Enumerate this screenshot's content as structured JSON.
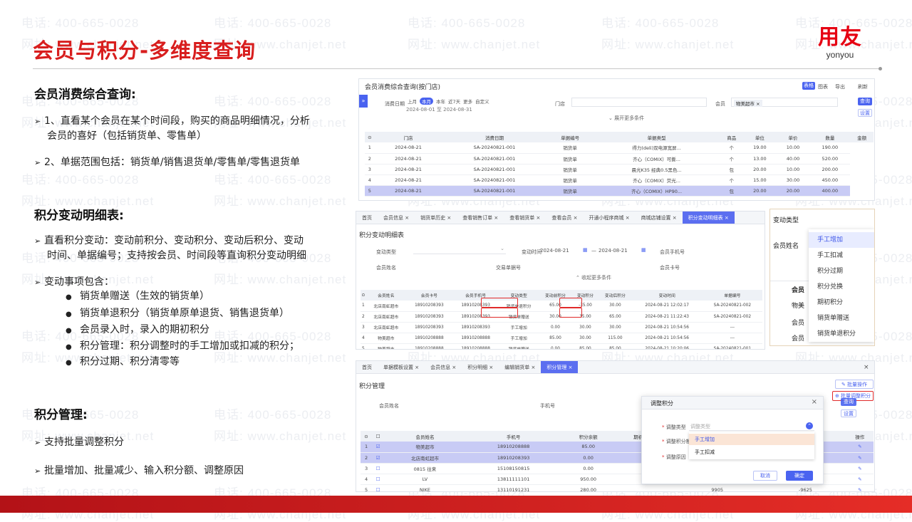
{
  "slide": {
    "title": "会员与积分-多维度查询",
    "logo_cn": "用友",
    "logo_en": "yonyou",
    "watermark_phone": "电话: 400-665-0028",
    "watermark_site": "网址: www.chanjet.net"
  },
  "left": {
    "section1_title": "会员消费综合查询:",
    "s1_item1_line1": "1、直看某个会员在某个时间段，购买的商品明细情况，分析",
    "s1_item1_line2": "会员的喜好（包括销货单、零售单）",
    "s1_item2": "2、单据范围包括：销货单/销售退货单/零售单/零售退货单",
    "section2_title": "积分变动明细表:",
    "s2_item1_line1": "直看积分变动：变动前积分、变动积分、变动后积分、变动",
    "s2_item1_line2": "时间、单据编号；支持按会员、时间段等直询积分变动明细",
    "s2_item2": "变动事项包含：",
    "s2_sub": [
      "销货单赠送（生效的销货单）",
      "销货单退积分（销货单原单退货、销售退货单）",
      "会员录入时，录入的期初积分",
      "积分管理：积分调整时的手工增加或扣减的积分；",
      "积分过期、积分清零等"
    ],
    "section3_title": "积分管理:",
    "s3_item1": "支持批量调整积分",
    "s3_item2": "批量增加、批量减少、输入积分额、调整原因"
  },
  "panel1": {
    "title": "会员消费综合查询(按门店)",
    "actions": [
      "表格",
      "图表",
      "导出",
      "刷新"
    ],
    "filter_date_label": "消费日期",
    "date_chips": [
      "上月",
      "本月",
      "本年",
      "近7天",
      "更多",
      "自定义"
    ],
    "date_range": "2024-08-01 至 2024-08-31",
    "store_label": "门店",
    "member_label": "会员",
    "member_tag": "物美超市 ×",
    "query_btn": "查询",
    "settings_btn": "设置",
    "expand": "展开更多条件",
    "columns": [
      "门店",
      "消费日期",
      "单据编号",
      "单据类型",
      "商品",
      "单位",
      "单价",
      "数量",
      "金额"
    ],
    "rows": [
      [
        "1",
        "2024-08-21",
        "SA-20240821-001",
        "销货单",
        "得力(deli)双电源宽屏...",
        "个",
        "19.00",
        "10.00",
        "190.00"
      ],
      [
        "2",
        "2024-08-21",
        "SA-20240821-001",
        "销货单",
        "齐心（COMIX）可撕...",
        "个",
        "13.00",
        "40.00",
        "520.00"
      ],
      [
        "3",
        "2024-08-21",
        "SA-20240821-001",
        "销货单",
        "晨光K35 经典0.5黑色...",
        "包",
        "20.00",
        "10.00",
        "200.00"
      ],
      [
        "4",
        "2024-08-21",
        "SA-20240821-001",
        "销货单",
        "齐心（COMIX）荧光...",
        "个",
        "15.00",
        "30.00",
        "450.00"
      ],
      [
        "5",
        "2024-08-21",
        "SA-20240821-001",
        "销货单",
        "齐心（COMIX）HP90...",
        "包",
        "20.00",
        "20.00",
        "400.00"
      ]
    ]
  },
  "panel2": {
    "tabs": [
      "首页",
      "会员信息 ×",
      "销货单历史 ×",
      "查看销售订单 ×",
      "查看销货单 ×",
      "查看会员 ×",
      "开通小程序商城 ×",
      "商城店铺设置 ×",
      "积分变动明细表 ×"
    ],
    "title": "积分变动明细表",
    "f_type": "变动类型",
    "f_time": "变动时间",
    "f_time_from": "2024-08-21",
    "f_time_to": "2024-08-21",
    "f_phone": "会员手机号",
    "f_name": "会员姓名",
    "f_doc": "交易单据号",
    "f_card": "会员卡号",
    "collapse": "收起更多条件",
    "columns": [
      "会员姓名",
      "会员卡号",
      "会员手机号",
      "变动类型",
      "变动前积分",
      "变动积分",
      "变动后积分",
      "变动时间",
      "单据编号"
    ],
    "rows": [
      [
        "1",
        "北店南虹超市",
        "18910208393",
        "18910208393",
        "销货单退积分",
        "65.00",
        "-35.00",
        "30.00",
        "2024-08-21 12:02:17",
        "SA-20240821-002"
      ],
      [
        "2",
        "北店南虹超市",
        "18910208393",
        "18910208393",
        "销货单赠送",
        "30.00",
        "35.00",
        "65.00",
        "2024-08-21 11:22:43",
        "SA-20240821-002"
      ],
      [
        "3",
        "北店南虹超市",
        "18910208393",
        "18910208393",
        "手工增加",
        "0.00",
        "30.00",
        "30.00",
        "2024-08-21 10:54:56",
        "---"
      ],
      [
        "4",
        "物美超市",
        "18910208888",
        "18910208888",
        "手工增加",
        "85.00",
        "30.00",
        "115.00",
        "2024-08-21 10:54:56",
        "---"
      ],
      [
        "5",
        "物美超市",
        "18910208888",
        "18910208888",
        "销货单赠送",
        "0.00",
        "85.00",
        "85.00",
        "2024-08-21 10:20:06",
        "SA-20240821-001"
      ]
    ]
  },
  "popup_type": {
    "label": "变动类型",
    "name_label": "会员姓名",
    "options": [
      "手工增加",
      "手工扣减",
      "积分过期",
      "积分兑换",
      "期初积分",
      "销货单赠送",
      "销货单退积分"
    ],
    "bg_rows": [
      "会员",
      "物美",
      "会员",
      "会员"
    ]
  },
  "panel3": {
    "tabs": [
      "首页",
      "单据模板设置 ×",
      "会员信息 ×",
      "积分明细 ×",
      "编辑销货单 ×",
      "积分管理 ×"
    ],
    "title": "积分管理",
    "f_name": "会员姓名",
    "f_phone": "手机号",
    "batch_op": "批量操作",
    "batch_adjust": "批量调整积分",
    "query": "查询",
    "settings": "设置",
    "columns": [
      "会员姓名",
      "手机号",
      "积分余额",
      "期初积分",
      "消费赠送积分...",
      "手工调整积分",
      "操作"
    ],
    "rows": [
      [
        "1",
        "物美超市",
        "18910208888",
        "85.00",
        "",
        "85",
        "0"
      ],
      [
        "2",
        "北店南虹超市",
        "18910208393",
        "0.00",
        "",
        "0.00",
        "0"
      ],
      [
        "3",
        "0815 往来",
        "15108150815",
        "0.00",
        "",
        "0",
        "0"
      ],
      [
        "4",
        "LV",
        "13811111101",
        "950.00",
        "",
        "950",
        "0"
      ],
      [
        "5",
        "NIKE",
        "13110191231",
        "280.00",
        "",
        "9905",
        "-9625"
      ]
    ]
  },
  "dialog": {
    "title": "调整积分",
    "f_type": "调整类型",
    "f_amount": "调整积分额",
    "f_reason": "调整原因",
    "placeholder": "调整类型",
    "options": [
      "手工增加",
      "手工扣减"
    ],
    "cancel": "取消",
    "ok": "确定"
  }
}
